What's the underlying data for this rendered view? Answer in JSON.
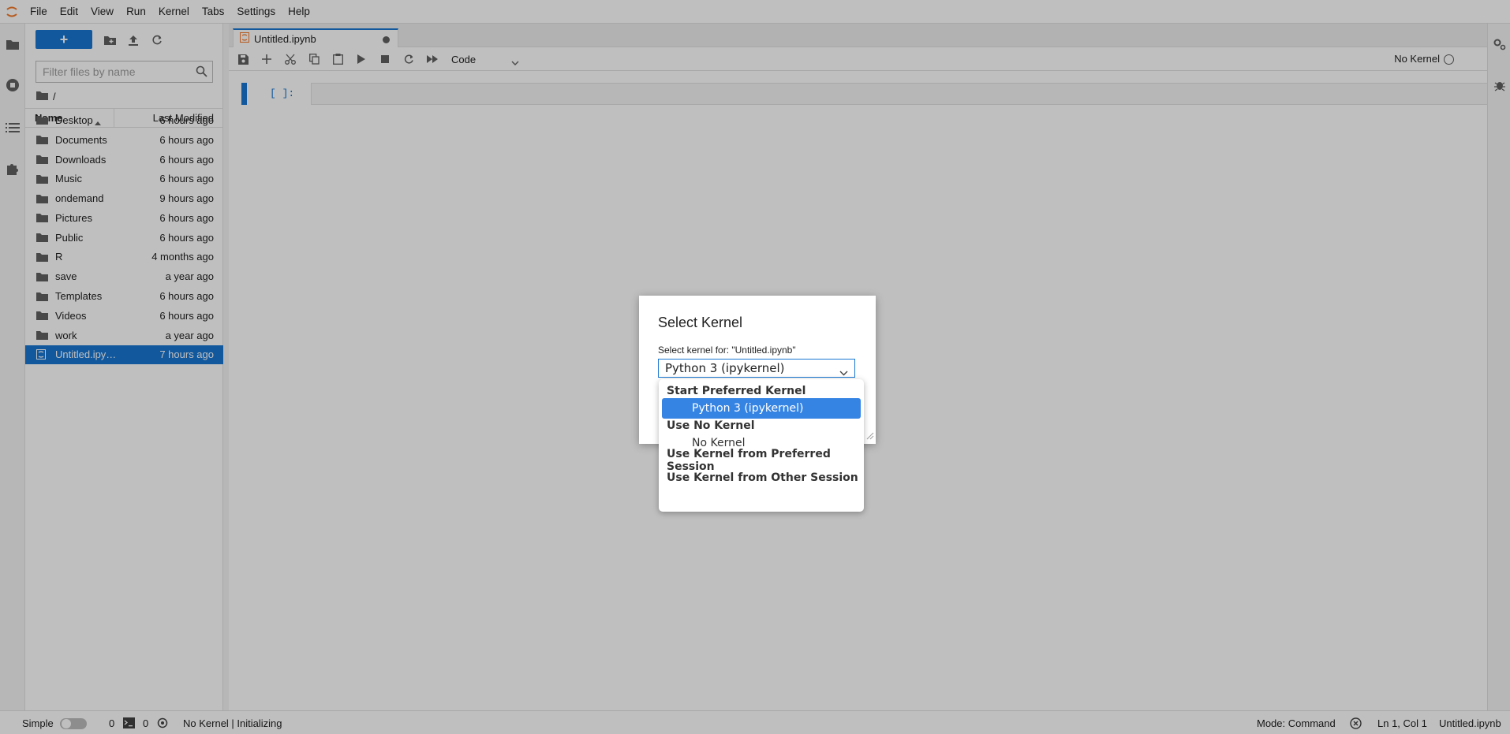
{
  "menubar": {
    "items": [
      "File",
      "Edit",
      "View",
      "Run",
      "Kernel",
      "Tabs",
      "Settings",
      "Help"
    ]
  },
  "filebrowser": {
    "new_label": "+",
    "filter_placeholder": "Filter files by name",
    "breadcrumb": "/",
    "header": {
      "name": "Name",
      "modified": "Last Modified"
    },
    "rows": [
      {
        "name": "Desktop",
        "modified": "6 hours ago",
        "type": "folder"
      },
      {
        "name": "Documents",
        "modified": "6 hours ago",
        "type": "folder"
      },
      {
        "name": "Downloads",
        "modified": "6 hours ago",
        "type": "folder"
      },
      {
        "name": "Music",
        "modified": "6 hours ago",
        "type": "folder"
      },
      {
        "name": "ondemand",
        "modified": "9 hours ago",
        "type": "folder"
      },
      {
        "name": "Pictures",
        "modified": "6 hours ago",
        "type": "folder"
      },
      {
        "name": "Public",
        "modified": "6 hours ago",
        "type": "folder"
      },
      {
        "name": "R",
        "modified": "4 months ago",
        "type": "folder"
      },
      {
        "name": "save",
        "modified": "a year ago",
        "type": "folder"
      },
      {
        "name": "Templates",
        "modified": "6 hours ago",
        "type": "folder"
      },
      {
        "name": "Videos",
        "modified": "6 hours ago",
        "type": "folder"
      },
      {
        "name": "work",
        "modified": "a year ago",
        "type": "folder"
      },
      {
        "name": "Untitled.ipy…",
        "modified": "7 hours ago",
        "type": "notebook",
        "selected": true
      }
    ]
  },
  "tab": {
    "label": "Untitled.ipynb"
  },
  "notebook": {
    "cell_type": "Code",
    "kernel_name": "No Kernel",
    "cell_prompt": "[ ]:"
  },
  "statusbar": {
    "simple": "Simple",
    "terminals": "0",
    "kernels": "0",
    "kernel_status": "No Kernel | Initializing",
    "mode": "Mode: Command",
    "position": "Ln 1, Col 1",
    "filename": "Untitled.ipynb"
  },
  "dialog": {
    "title": "Select Kernel",
    "label": "Select kernel for: \"Untitled.ipynb\"",
    "selected": "Python 3 (ipykernel)",
    "options": [
      {
        "label": "Start Preferred Kernel",
        "kind": "group"
      },
      {
        "label": "Python 3 (ipykernel)",
        "kind": "option",
        "highlight": true
      },
      {
        "label": "Use No Kernel",
        "kind": "group"
      },
      {
        "label": "No Kernel",
        "kind": "option"
      },
      {
        "label": "Use Kernel from Preferred Session",
        "kind": "group"
      },
      {
        "label": "Use Kernel from Other Session",
        "kind": "group"
      }
    ]
  },
  "colors": {
    "accent": "#1976d2",
    "dropdown_highlight": "#3584e4",
    "logo": "#f37726"
  }
}
